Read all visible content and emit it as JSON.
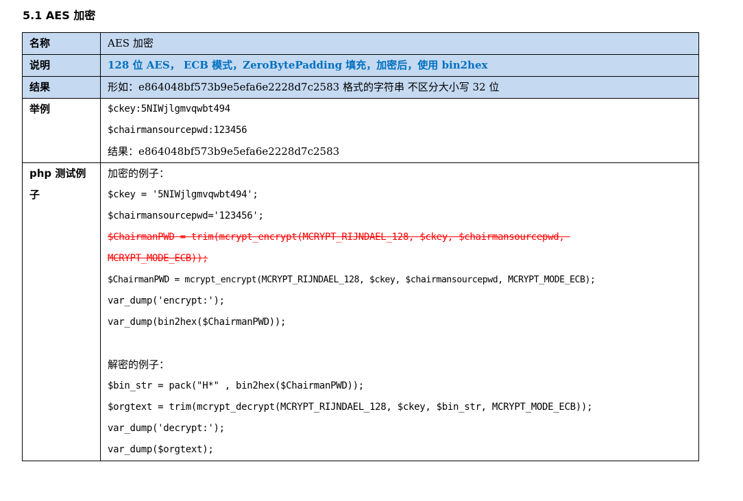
{
  "section": {
    "title": "5.1 AES 加密"
  },
  "rows": {
    "name": {
      "label": "名称",
      "value": "AES 加密"
    },
    "desc": {
      "label": "说明",
      "value": "128 位 AES， ECB 模式，ZeroBytePadding 填充，加密后，使用 bin2hex"
    },
    "result": {
      "label": "结果",
      "value": "形如：e864048bf573b9e5efa6e2228d7c2583 格式的字符串 不区分大小写  32 位"
    },
    "example": {
      "label": "举例",
      "lines": [
        "$ckey:5NIWjlgmvqwbt494",
        "$chairmansourcepwd:123456",
        "结果：e864048bf573b9e5efa6e2228d7c2583"
      ]
    },
    "php": {
      "label_line1": "php 测试例",
      "label_line2": "子",
      "encrypt_heading": "加密的例子：",
      "line_ckey": "$ckey = '5NIWjlgmvqwbt494';",
      "line_pwd": "$chairmansourcepwd='123456';",
      "struck_line1": "$ChairmanPWD = trim(mcrypt_encrypt(MCRYPT_RIJNDAEL_128, $ckey, $chairmansourcepwd, ",
      "struck_line2": "MCRYPT_MODE_ECB));",
      "line_encrypt": "$ChairmanPWD = mcrypt_encrypt(MCRYPT_RIJNDAEL_128, $ckey, $chairmansourcepwd, MCRYPT_MODE_ECB);",
      "line_dump1": "var_dump('encrypt:');",
      "line_dump2": "var_dump(bin2hex($ChairmanPWD));",
      "decrypt_heading": "解密的例子：",
      "line_binstr": "$bin_str = pack(\"H*\" , bin2hex($ChairmanPWD));",
      "line_orgtext": "$orgtext = trim(mcrypt_decrypt(MCRYPT_RIJNDAEL_128, $ckey, $bin_str, MCRYPT_MODE_ECB));",
      "line_dump3": "var_dump('decrypt:');",
      "line_dump4": "var_dump($orgtext);"
    }
  },
  "colors": {
    "header_fill": "#c5d9f1",
    "desc_text": "#0070c0",
    "struck_text": "#ff0000"
  }
}
